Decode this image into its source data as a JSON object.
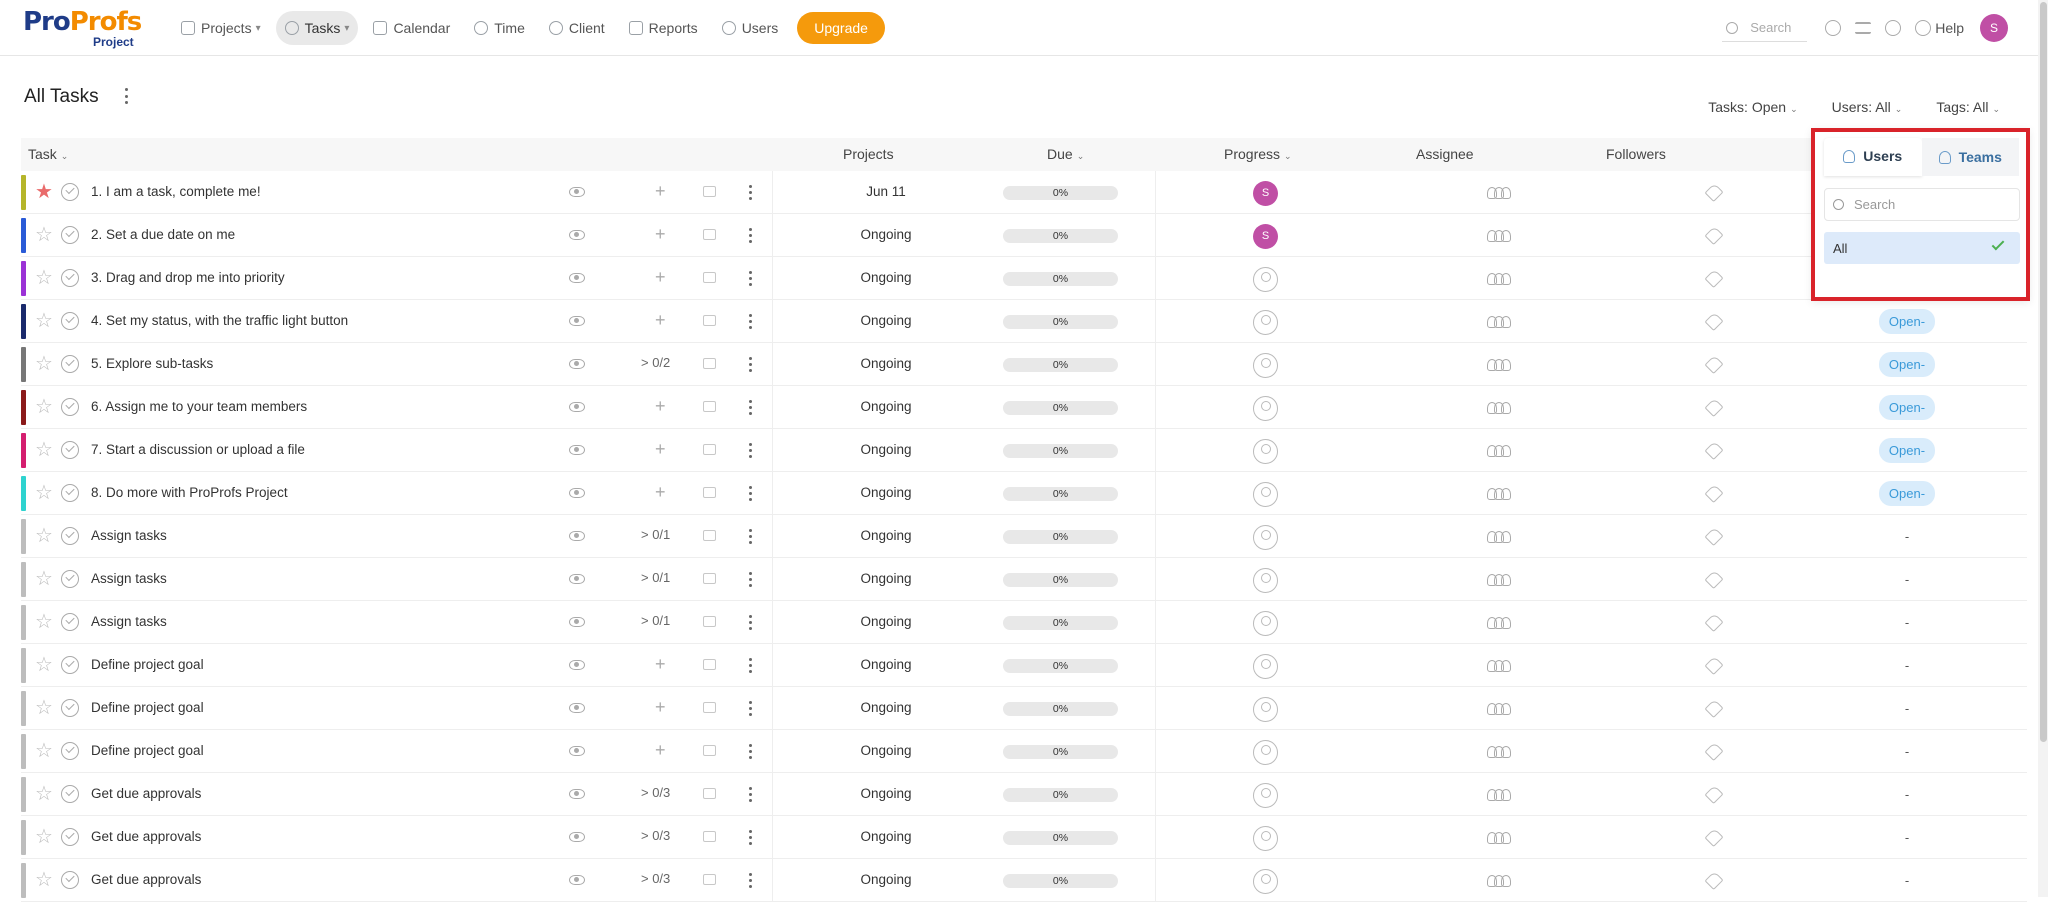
{
  "brand": {
    "name_part1": "Pro",
    "name_part2": "Profs",
    "product": "Project"
  },
  "nav": [
    {
      "label": "Projects",
      "icon": "folder-icon",
      "caret": "▾"
    },
    {
      "label": "Tasks",
      "icon": "check-circle-icon",
      "caret": "▾",
      "active": true
    },
    {
      "label": "Calendar",
      "icon": "calendar-icon"
    },
    {
      "label": "Time",
      "icon": "clock-icon"
    },
    {
      "label": "Client",
      "icon": "person-icon"
    },
    {
      "label": "Reports",
      "icon": "bar-chart-icon"
    },
    {
      "label": "Users",
      "icon": "user-icon"
    }
  ],
  "upgrade_label": "Upgrade",
  "top_search_placeholder": "Search",
  "help_label": "Help",
  "user_initial": "S",
  "page_title": "All Tasks",
  "filters": {
    "tasks": "Tasks: Open",
    "users": "Users: All",
    "tags": "Tags: All"
  },
  "columns": {
    "task": "Task",
    "projects": "Projects",
    "due": "Due",
    "progress": "Progress",
    "assignee": "Assignee",
    "followers": "Followers"
  },
  "rows": [
    {
      "name": "1. I am a task, complete me!",
      "color": "#b5b52a",
      "starred": true,
      "sub": "+",
      "due": "Jun 11",
      "progress": "0%",
      "assignee": "S",
      "status": ""
    },
    {
      "name": "2. Set a due date on me",
      "color": "#2a5bd7",
      "starred": false,
      "sub": "+",
      "due": "Ongoing",
      "progress": "0%",
      "assignee": "S",
      "status": ""
    },
    {
      "name": "3. Drag and drop me into priority",
      "color": "#9b32d6",
      "starred": false,
      "sub": "+",
      "due": "Ongoing",
      "progress": "0%",
      "assignee": "",
      "status": ""
    },
    {
      "name": "4. Set my status, with the traffic light button",
      "color": "#1a2a6c",
      "starred": false,
      "sub": "+",
      "due": "Ongoing",
      "progress": "0%",
      "assignee": "",
      "status": "Open-"
    },
    {
      "name": "5. Explore sub-tasks",
      "color": "#777777",
      "starred": false,
      "sub": "> 0/2",
      "due": "Ongoing",
      "progress": "0%",
      "assignee": "",
      "status": "Open-"
    },
    {
      "name": "6. Assign me to your team members",
      "color": "#8b1a1a",
      "starred": false,
      "sub": "+",
      "due": "Ongoing",
      "progress": "0%",
      "assignee": "",
      "status": "Open-"
    },
    {
      "name": "7. Start a discussion or upload a file",
      "color": "#d41e6f",
      "starred": false,
      "sub": "+",
      "due": "Ongoing",
      "progress": "0%",
      "assignee": "",
      "status": "Open-"
    },
    {
      "name": "8. Do more with ProProfs Project",
      "color": "#2ed3cf",
      "starred": false,
      "sub": "+",
      "due": "Ongoing",
      "progress": "0%",
      "assignee": "",
      "status": "Open-"
    },
    {
      "name": "Assign tasks",
      "color": "#bdbdbd",
      "starred": false,
      "sub": "> 0/1",
      "due": "Ongoing",
      "progress": "0%",
      "assignee": "",
      "status": "-"
    },
    {
      "name": "Assign tasks",
      "color": "#bdbdbd",
      "starred": false,
      "sub": "> 0/1",
      "due": "Ongoing",
      "progress": "0%",
      "assignee": "",
      "status": "-"
    },
    {
      "name": "Assign tasks",
      "color": "#bdbdbd",
      "starred": false,
      "sub": "> 0/1",
      "due": "Ongoing",
      "progress": "0%",
      "assignee": "",
      "status": "-"
    },
    {
      "name": "Define project goal",
      "color": "#bdbdbd",
      "starred": false,
      "sub": "+",
      "due": "Ongoing",
      "progress": "0%",
      "assignee": "",
      "status": "-"
    },
    {
      "name": "Define project goal",
      "color": "#bdbdbd",
      "starred": false,
      "sub": "+",
      "due": "Ongoing",
      "progress": "0%",
      "assignee": "",
      "status": "-"
    },
    {
      "name": "Define project goal",
      "color": "#bdbdbd",
      "starred": false,
      "sub": "+",
      "due": "Ongoing",
      "progress": "0%",
      "assignee": "",
      "status": "-"
    },
    {
      "name": "Get due approvals",
      "color": "#bdbdbd",
      "starred": false,
      "sub": "> 0/3",
      "due": "Ongoing",
      "progress": "0%",
      "assignee": "",
      "status": "-"
    },
    {
      "name": "Get due approvals",
      "color": "#bdbdbd",
      "starred": false,
      "sub": "> 0/3",
      "due": "Ongoing",
      "progress": "0%",
      "assignee": "",
      "status": "-"
    },
    {
      "name": "Get due approvals",
      "color": "#bdbdbd",
      "starred": false,
      "sub": "> 0/3",
      "due": "Ongoing",
      "progress": "0%",
      "assignee": "",
      "status": "-"
    }
  ],
  "dropdown": {
    "tab_users": "Users",
    "tab_teams": "Teams",
    "search_placeholder": "Search",
    "option_all": "All"
  },
  "colors": {
    "accent_orange": "#f59a0c",
    "avatar": "#c04fa5",
    "highlight_border": "#d9232a",
    "status_bg": "#d9ecfb"
  }
}
